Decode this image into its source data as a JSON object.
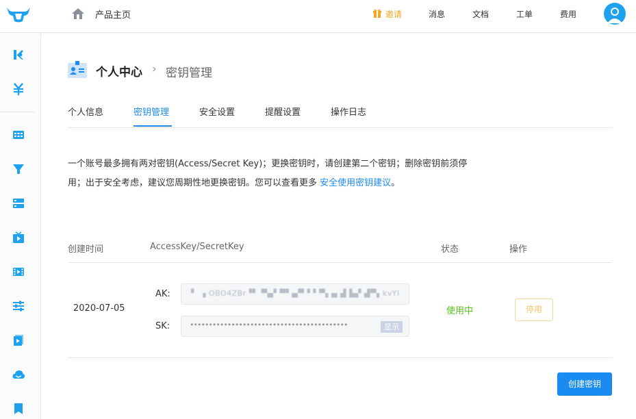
{
  "header": {
    "product_home": "产品主页",
    "nav": {
      "invite": "邀请",
      "messages": "消息",
      "docs": "文档",
      "tickets": "工单",
      "billing": "费用"
    }
  },
  "sidebar": {
    "icons": [
      "letter-k-icon",
      "yuan-icon",
      "grid-icon",
      "funnel-icon",
      "server-icon",
      "tv-icon",
      "film-icon",
      "sliders-icon",
      "video-icon",
      "cloud-icon",
      "bookmark-icon"
    ]
  },
  "page": {
    "title": "个人中心",
    "separator": "›",
    "subtitle": "密钥管理"
  },
  "tabs": [
    {
      "label": "个人信息",
      "active": false
    },
    {
      "label": "密钥管理",
      "active": true
    },
    {
      "label": "安全设置",
      "active": false
    },
    {
      "label": "提醒设置",
      "active": false
    },
    {
      "label": "操作日志",
      "active": false
    }
  ],
  "notice": {
    "line1": "一个账号最多拥有两对密钥(Access/Secret Key)；更换密钥时，请创建第二个密钥；删除密钥前须停",
    "line2_prefix": "用；出于安全考虑，建议您周期性地更换密钥。您可以查看更多 ",
    "link": "安全使用密钥建议",
    "line2_suffix": "。"
  },
  "table": {
    "headers": {
      "created": "创建时间",
      "keys": "AccessKey/SecretKey",
      "status": "状态",
      "action": "操作"
    },
    "rows": [
      {
        "created": "2020-07-05",
        "ak_label": "AK:",
        "ak_value": "▘ ▗ OBO4ZBr▝▘ ▀▄▘▀▘▄▀▝ ▘▀▖▄ ▟ ▙▞ ▟▀▖kvYl",
        "sk_label": "SK:",
        "sk_value": "••••••••••••••••••••••••••••••••••••••••••",
        "show_label": "显示",
        "status": "使用中",
        "action": "停用"
      }
    ]
  },
  "create_button": "创建密钥",
  "colors": {
    "primary": "#1a8bf0",
    "invite": "#f5a623",
    "active_status": "#52c41a",
    "disable_border": "#f5d89a"
  }
}
